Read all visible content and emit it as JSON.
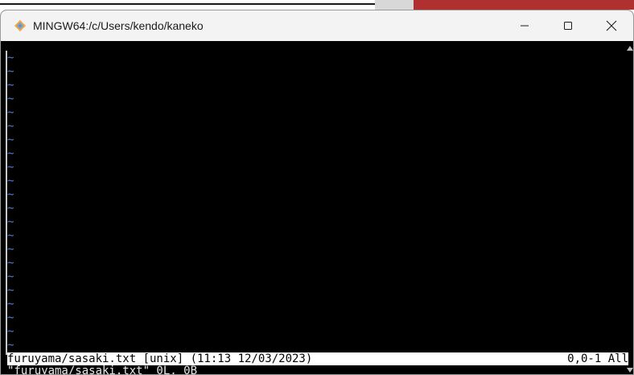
{
  "window": {
    "title": "MINGW64:/c/Users/kendo/kaneko"
  },
  "colors": {
    "terminal_bg": "#000000",
    "tilde": "#4b7cdc",
    "statusline_bg": "#ffffff",
    "titlebar_bg": "#f3f3f3"
  },
  "editor": {
    "tildes": [
      "~",
      "~",
      "~",
      "~",
      "~",
      "~",
      "~",
      "~",
      "~",
      "~",
      "~",
      "~",
      "~",
      "~",
      "~",
      "~",
      "~",
      "~",
      "~",
      "~",
      "~",
      "~"
    ],
    "statusline": {
      "left": "furuyama/sasaki.txt [unix] (11:13 12/03/2023)",
      "right": "0,0-1 All"
    },
    "message": "\"furuyama/sasaki.txt\" 0L, 0B"
  }
}
